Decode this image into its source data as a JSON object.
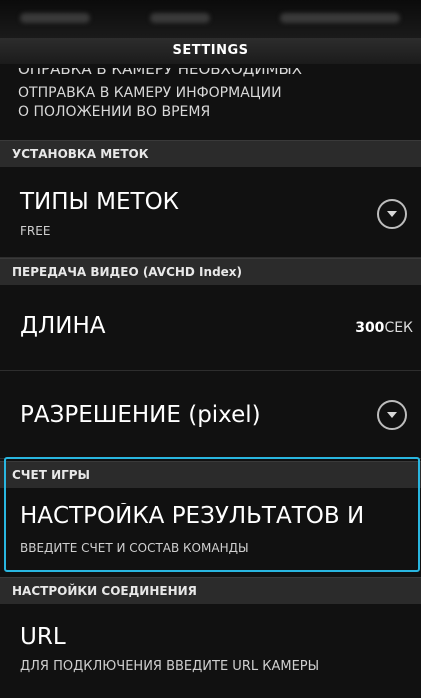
{
  "app": {
    "title": "SETTINGS"
  },
  "top_cut_text": "ОПРАВКА В КАМЕРУ НЕОБХОДИМЫХ",
  "info": {
    "line1": "ОТПРАВКА В КАМЕРУ ИНФОРМАЦИИ",
    "line2": "О ПОЛОЖЕНИИ ВО ВРЕМЯ"
  },
  "sections": {
    "marks": "УСТАНОВКА МЕТОК",
    "video": "ПЕРЕДАЧА ВИДЕО (AVCHD Index)",
    "score": "СЧЕТ ИГРЫ",
    "connection": "НАСТРОЙКИ СОЕДИНЕНИЯ"
  },
  "items": {
    "mark_types": {
      "title": "ТИПЫ МЕТОК",
      "subtitle": "FREE"
    },
    "length": {
      "title": "ДЛИНА",
      "value": "300",
      "unit": "СЕК"
    },
    "resolution": {
      "title": "РАЗРЕШЕНИЕ (pixel)"
    },
    "score_settings": {
      "title": "НАСТРОЙКА РЕЗУЛЬТАТОВ И",
      "subtitle": "ВВЕДИТЕ СЧЕТ И СОСТАВ КОМАНДЫ"
    },
    "url": {
      "title": "URL",
      "subtitle": "ДЛЯ ПОДКЛЮЧЕНИЯ ВВЕДИТЕ URL КАМЕРЫ"
    }
  },
  "colors": {
    "highlight": "#29b6e0",
    "section_bg": "#2b2b2b"
  },
  "icons": {
    "dropdown": "chevron-down-circle-icon"
  }
}
